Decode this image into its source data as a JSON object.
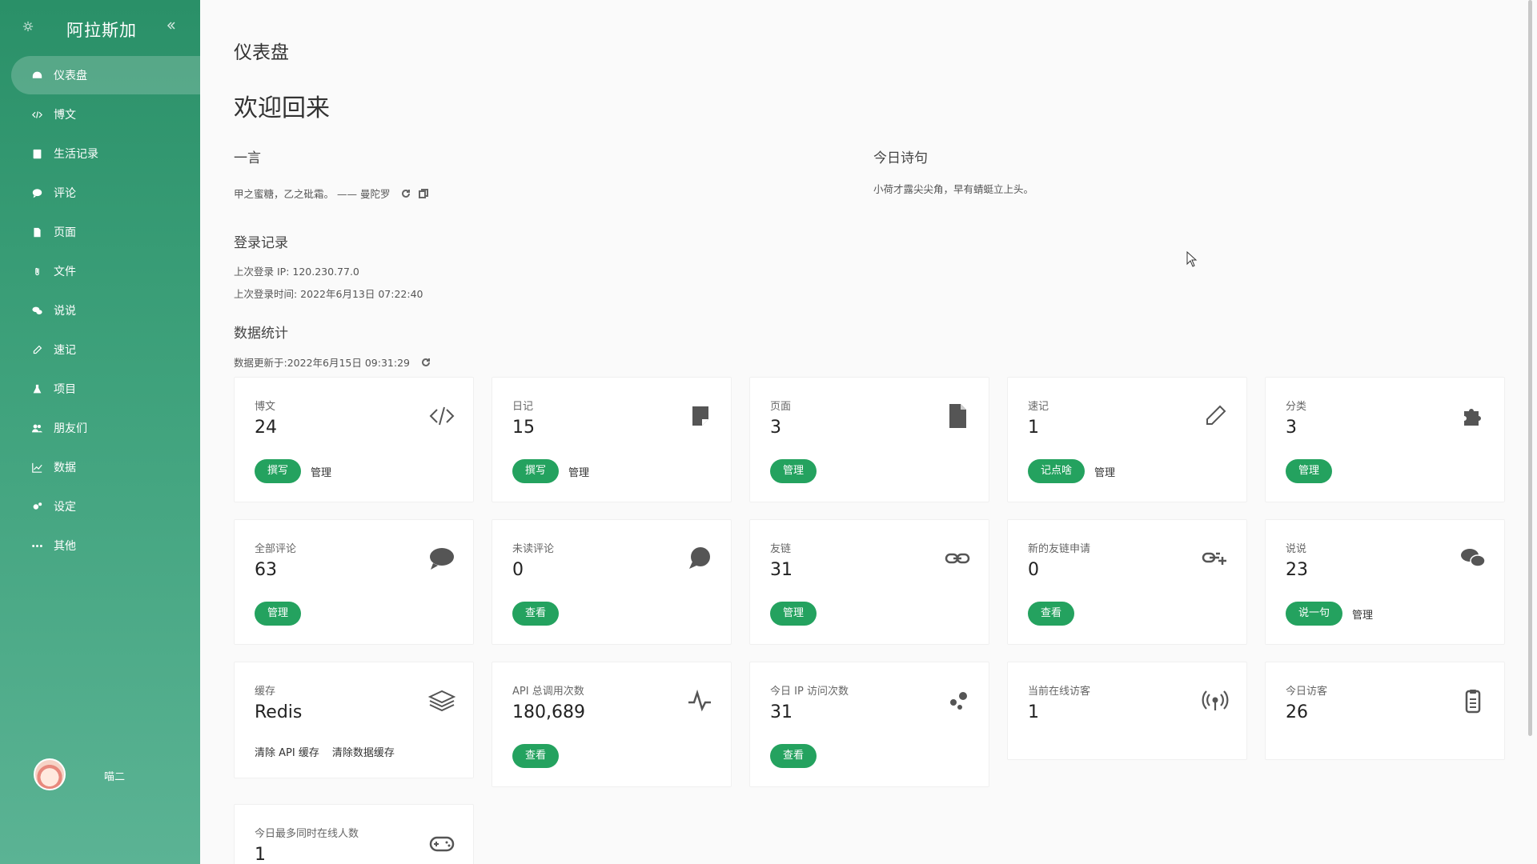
{
  "sidebar": {
    "brand": "阿拉斯加",
    "items": [
      {
        "label": "仪表盘",
        "icon": "dashboard-icon"
      },
      {
        "label": "博文",
        "icon": "code-icon"
      },
      {
        "label": "生活记录",
        "icon": "book-icon"
      },
      {
        "label": "评论",
        "icon": "comment-icon"
      },
      {
        "label": "页面",
        "icon": "file-icon"
      },
      {
        "label": "文件",
        "icon": "paperclip-icon"
      },
      {
        "label": "说说",
        "icon": "comments-icon"
      },
      {
        "label": "速记",
        "icon": "pencil-icon"
      },
      {
        "label": "项目",
        "icon": "flask-icon"
      },
      {
        "label": "朋友们",
        "icon": "users-icon"
      },
      {
        "label": "数据",
        "icon": "chart-icon"
      },
      {
        "label": "设定",
        "icon": "cogs-icon"
      },
      {
        "label": "其他",
        "icon": "ellipsis-icon"
      }
    ],
    "user": {
      "name": "喵二"
    }
  },
  "header": {
    "page_title": "仪表盘",
    "welcome": "欢迎回来"
  },
  "hitokoto": {
    "title": "一言",
    "text": "甲之蜜糖，乙之砒霜。 —— 曼陀罗"
  },
  "poem": {
    "title": "今日诗句",
    "text": "小荷才露尖尖角，早有蜻蜓立上头。"
  },
  "login": {
    "title": "登录记录",
    "last_ip": "上次登录 IP: 120.230.77.0",
    "last_time": "上次登录时间: 2022年6月13日 07:22:40"
  },
  "stats": {
    "title": "数据统计",
    "updated": "数据更新于:2022年6月15日 09:31:29",
    "cards": [
      {
        "label": "博文",
        "value": "24",
        "icon": "code-icon",
        "primary": "撰写",
        "secondary": "管理"
      },
      {
        "label": "日记",
        "value": "15",
        "icon": "sticky-note-icon",
        "primary": "撰写",
        "secondary": "管理"
      },
      {
        "label": "页面",
        "value": "3",
        "icon": "file-icon",
        "primary": "管理",
        "secondary": ""
      },
      {
        "label": "速记",
        "value": "1",
        "icon": "pencil-icon",
        "primary": "记点啥",
        "secondary": "管理"
      },
      {
        "label": "分类",
        "value": "3",
        "icon": "puzzle-icon",
        "primary": "管理",
        "secondary": ""
      },
      {
        "label": "全部评论",
        "value": "63",
        "icon": "comment-icon",
        "primary": "管理",
        "secondary": ""
      },
      {
        "label": "未读评论",
        "value": "0",
        "icon": "comment-dots-icon",
        "primary": "查看",
        "secondary": ""
      },
      {
        "label": "友链",
        "value": "31",
        "icon": "link-icon",
        "primary": "管理",
        "secondary": ""
      },
      {
        "label": "新的友链申请",
        "value": "0",
        "icon": "link-plus-icon",
        "primary": "查看",
        "secondary": ""
      },
      {
        "label": "说说",
        "value": "23",
        "icon": "comments-icon",
        "primary": "说一句",
        "secondary": "管理"
      },
      {
        "label": "缓存",
        "value": "Redis",
        "icon": "layers-icon",
        "links": [
          "清除 API 缓存",
          "清除数据缓存"
        ]
      },
      {
        "label": "API 总调用次数",
        "value": "180,689",
        "icon": "activity-icon",
        "primary": "查看",
        "secondary": ""
      },
      {
        "label": "今日 IP 访问次数",
        "value": "31",
        "icon": "dots-icon",
        "primary": "查看",
        "secondary": ""
      },
      {
        "label": "当前在线访客",
        "value": "1",
        "icon": "broadcast-icon"
      },
      {
        "label": "今日访客",
        "value": "26",
        "icon": "clipboard-icon"
      },
      {
        "label": "今日最多同时在线人数",
        "value": "1",
        "icon": "gamepad-icon"
      }
    ]
  }
}
